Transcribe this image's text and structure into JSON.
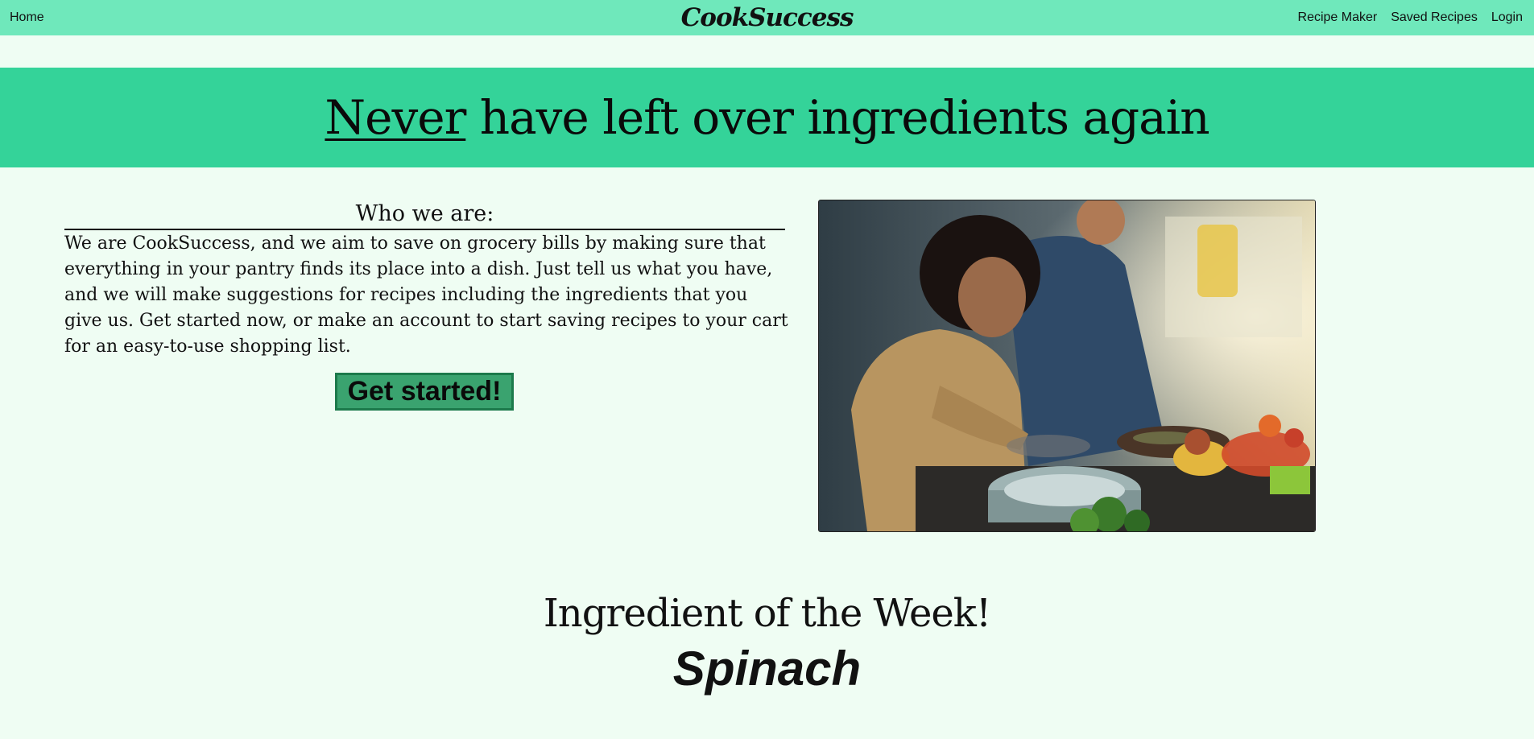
{
  "nav": {
    "home": "Home",
    "brand": "CookSuccess",
    "links": [
      "Recipe Maker",
      "Saved Recipes",
      "Login"
    ]
  },
  "hero": {
    "emphasis": "Never",
    "rest": " have left over ingredients again"
  },
  "about": {
    "heading": "Who we are:",
    "body": "We are CookSuccess, and we aim to save on grocery bills by making sure that everything in your pantry finds its place into a dish. Just tell us what you have, and we will make suggestions for recipes including the ingredients that you give us. Get started now, or make an account to start saving recipes to your cart for an easy-to-use shopping list.",
    "cta": "Get started!"
  },
  "ingredient_of_week": {
    "title": "Ingredient of the Week!",
    "name": "Spinach"
  },
  "colors": {
    "nav_bg": "#6fe8bb",
    "hero_bg": "#34d399",
    "page_bg": "#effdf3",
    "button_bg": "#3aa36f",
    "button_border": "#1c7a4b"
  }
}
